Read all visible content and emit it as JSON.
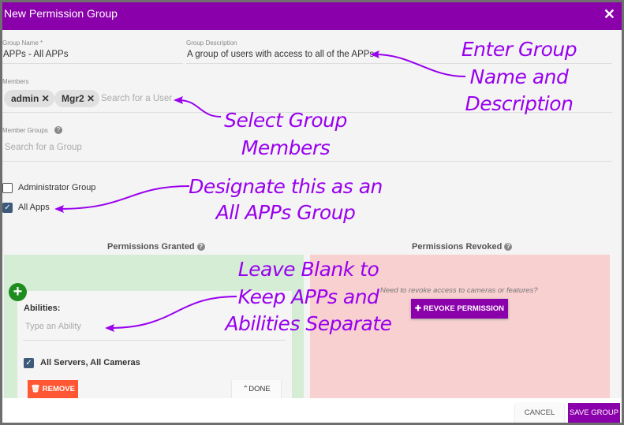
{
  "dialog": {
    "title": "New Permission Group"
  },
  "form": {
    "group_name_label": "Group Name *",
    "group_name_value": "APPs - All APPs",
    "group_desc_label": "Group Description",
    "group_desc_value": "A group of users with access to all of the APPs",
    "members_label": "Members",
    "members": [
      "admin",
      "Mgr2"
    ],
    "members_placeholder": "Search for a User",
    "member_groups_label": "Member Groups",
    "member_groups_placeholder": "Search for a Group",
    "admin_group_label": "Administrator Group",
    "admin_group_checked": false,
    "all_apps_label": "All Apps",
    "all_apps_checked": true
  },
  "permissions": {
    "granted_title": "Permissions Granted",
    "revoked_title": "Permissions Revoked",
    "abilities_label": "Abilities:",
    "abilities_placeholder": "Type an Ability",
    "all_servers_label": "All Servers, All Cameras",
    "all_servers_checked": true,
    "remove_label": "REMOVE",
    "done_label": "DONE",
    "revoke_prompt": "Need to revoke access to cameras or features?",
    "revoke_button": "REVOKE PERMISSION"
  },
  "footer": {
    "cancel": "CANCEL",
    "save": "SAVE GROUP"
  },
  "annotations": {
    "a1": [
      "Enter Group",
      "Name and",
      "Description"
    ],
    "a2": [
      "Select Group",
      "Members"
    ],
    "a3": [
      "Designate this as an",
      "All APPs Group"
    ],
    "a4": [
      "Leave Blank to",
      "Keep APPs and",
      "Abilities Separate"
    ]
  },
  "colors": {
    "header": "#8a00ab",
    "annotation": "#9900ee",
    "granted_bg": "#d5ecd5",
    "revoked_bg": "#f9d0d0",
    "remove": "#ff5733"
  }
}
